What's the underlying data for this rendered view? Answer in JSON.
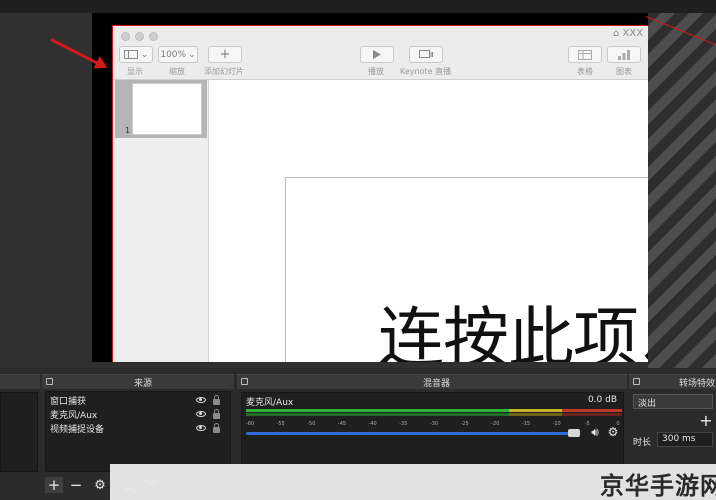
{
  "keynote": {
    "window_title": "XXX",
    "toolbar": {
      "view_label": "显示",
      "zoom_value": "100%",
      "zoom_label": "缩放",
      "add_slide_label": "添加幻灯片",
      "play_label": "播放",
      "keynote_live_label": "Keynote 直播",
      "table_label": "表格",
      "chart_label": "图表"
    },
    "slide_number": "1",
    "slide_text": "连按此项以"
  },
  "docks": {
    "sources": {
      "title": "来源",
      "items": [
        {
          "label": "窗口捕获"
        },
        {
          "label": "麦克风/Aux"
        },
        {
          "label": "视频捕捉设备"
        }
      ]
    },
    "mixer": {
      "title": "混音器",
      "channel_name": "麦克风/Aux",
      "channel_db": "0.0 dB",
      "ticks": [
        "-60",
        "-55",
        "-50",
        "-45",
        "-40",
        "-35",
        "-30",
        "-25",
        "-20",
        "-15",
        "-10",
        "-5",
        "0"
      ],
      "volume_level": 0.97
    },
    "transitions": {
      "title": "转场特效",
      "selected": "淡出",
      "duration_label": "时长",
      "duration_value": "300 ms"
    }
  },
  "watermark": "京华手游网",
  "colors": {
    "accent_red": "#d11a1a",
    "meter_green": "#2fb43a",
    "meter_yellow": "#c8b52a",
    "meter_red": "#c03a2a",
    "slider_blue": "#2e6bd2"
  },
  "icons": {
    "view": "sidebar-icon",
    "add": "plus-icon",
    "play": "play-icon",
    "live": "display-icon",
    "table": "table-icon",
    "chart": "chart-icon",
    "visibility": "eye-icon",
    "lock": "lock-icon",
    "speaker": "speaker-icon",
    "settings": "gear-icon"
  }
}
